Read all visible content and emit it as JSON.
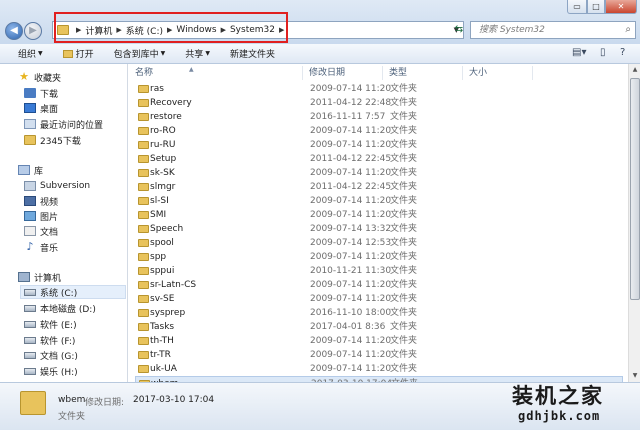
{
  "window": {
    "controls": {
      "minimize": "▭",
      "maximize": "□",
      "close": "✕"
    }
  },
  "address": {
    "segments": [
      "计算机",
      "系统 (C:)",
      "Windows",
      "System32"
    ],
    "search_placeholder": "搜索 System32"
  },
  "toolbar": {
    "organize": "组织",
    "open": "打开",
    "include_in_library": "包含到库中",
    "share": "共享",
    "new_folder": "新建文件夹"
  },
  "sidebar": {
    "favorites_header": "收藏夹",
    "favorites": [
      "下载",
      "桌面",
      "最近访问的位置",
      "2345下载"
    ],
    "libraries_header": "库",
    "libraries": [
      "Subversion",
      "视频",
      "图片",
      "文档",
      "音乐"
    ],
    "computer_header": "计算机",
    "drives": [
      "系统 (C:)",
      "本地磁盘 (D:)",
      "软件 (E:)",
      "软件 (F:)",
      "文档 (G:)",
      "娱乐 (H:)"
    ]
  },
  "columns": {
    "name": "名称",
    "modified": "修改日期",
    "type": "类型",
    "size": "大小"
  },
  "files": [
    {
      "name": "ras",
      "modified": "2009-07-14 11:20",
      "type": "文件夹"
    },
    {
      "name": "Recovery",
      "modified": "2011-04-12 22:48",
      "type": "文件夹"
    },
    {
      "name": "restore",
      "modified": "2016-11-11 7:57",
      "type": "文件夹"
    },
    {
      "name": "ro-RO",
      "modified": "2009-07-14 11:20",
      "type": "文件夹"
    },
    {
      "name": "ru-RU",
      "modified": "2009-07-14 11:20",
      "type": "文件夹"
    },
    {
      "name": "Setup",
      "modified": "2011-04-12 22:45",
      "type": "文件夹"
    },
    {
      "name": "sk-SK",
      "modified": "2009-07-14 11:20",
      "type": "文件夹"
    },
    {
      "name": "slmgr",
      "modified": "2011-04-12 22:45",
      "type": "文件夹"
    },
    {
      "name": "sl-SI",
      "modified": "2009-07-14 11:20",
      "type": "文件夹"
    },
    {
      "name": "SMI",
      "modified": "2009-07-14 11:20",
      "type": "文件夹"
    },
    {
      "name": "Speech",
      "modified": "2009-07-14 13:32",
      "type": "文件夹"
    },
    {
      "name": "spool",
      "modified": "2009-07-14 12:53",
      "type": "文件夹"
    },
    {
      "name": "spp",
      "modified": "2009-07-14 11:20",
      "type": "文件夹"
    },
    {
      "name": "sppui",
      "modified": "2010-11-21 11:30",
      "type": "文件夹"
    },
    {
      "name": "sr-Latn-CS",
      "modified": "2009-07-14 11:20",
      "type": "文件夹"
    },
    {
      "name": "sv-SE",
      "modified": "2009-07-14 11:20",
      "type": "文件夹"
    },
    {
      "name": "sysprep",
      "modified": "2016-11-10 18:00",
      "type": "文件夹"
    },
    {
      "name": "Tasks",
      "modified": "2017-04-01 8:36",
      "type": "文件夹"
    },
    {
      "name": "th-TH",
      "modified": "2009-07-14 11:20",
      "type": "文件夹"
    },
    {
      "name": "tr-TR",
      "modified": "2009-07-14 11:20",
      "type": "文件夹"
    },
    {
      "name": "uk-UA",
      "modified": "2009-07-14 11:20",
      "type": "文件夹"
    },
    {
      "name": "wbem",
      "modified": "2017-03-10 17:04",
      "type": "文件夹",
      "selected": true
    }
  ],
  "details": {
    "name": "wbem",
    "modified_label": "修改日期:",
    "modified_value": "2017-03-10 17:04",
    "type": "文件夹"
  },
  "watermark": {
    "title": "装机之家",
    "url": "gdhjbk.com"
  },
  "colors": {
    "highlight_box": "#e02020",
    "selection": "#dbe8f7",
    "folder": "#e8c35c"
  }
}
